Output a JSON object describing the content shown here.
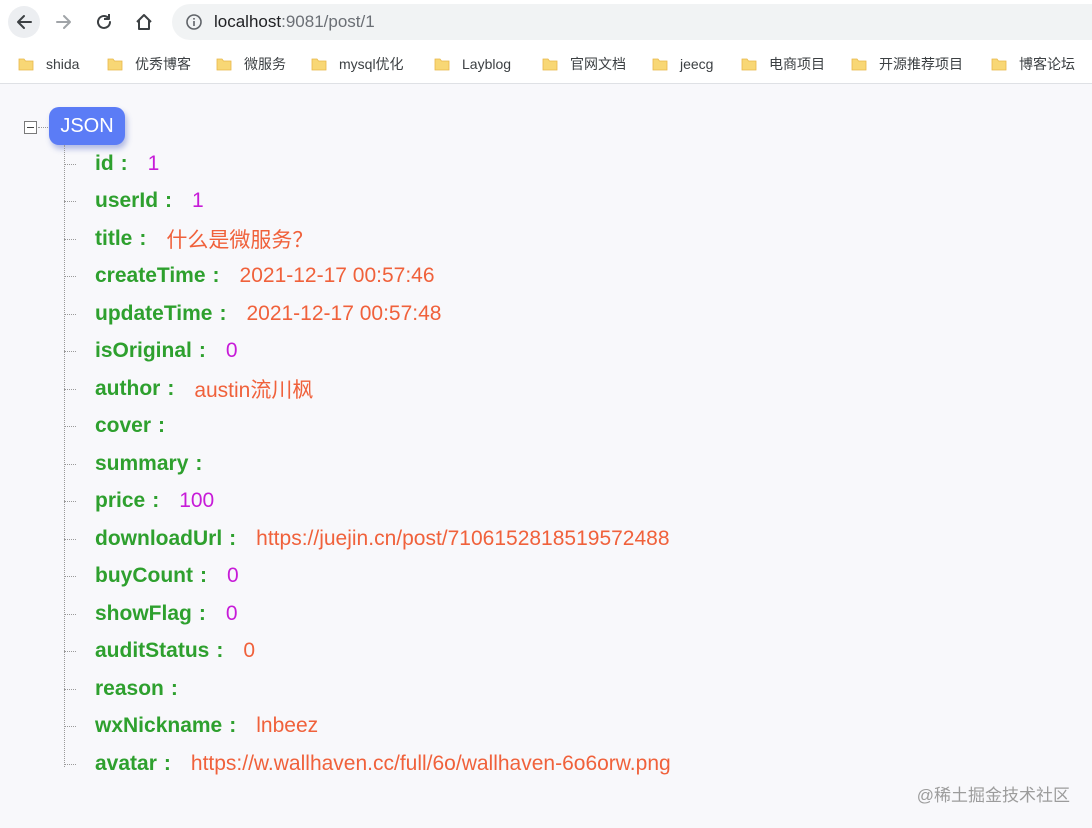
{
  "browser": {
    "url_host": "localhost",
    "url_path": ":9081/post/1",
    "bookmarks": [
      "shida",
      "优秀博客",
      "微服务",
      "mysql优化",
      "Layblog",
      "官网文档",
      "jeecg",
      "电商项目",
      "开源推荐项目",
      "博客论坛"
    ]
  },
  "viewer": {
    "root_label": "JSON",
    "rows": [
      {
        "key": "id",
        "colon": ":",
        "value": "1",
        "type": "num"
      },
      {
        "key": "userId",
        "colon": ":",
        "value": "1",
        "type": "num"
      },
      {
        "key": "title",
        "colon": ":",
        "value": "什么是微服务？",
        "type": "str"
      },
      {
        "key": "createTime",
        "colon": ":",
        "value": "2021-12-17 00:57:46",
        "type": "str"
      },
      {
        "key": "updateTime",
        "colon": ":",
        "value": "2021-12-17 00:57:48",
        "type": "str"
      },
      {
        "key": "isOriginal",
        "colon": ":",
        "value": "0",
        "type": "num"
      },
      {
        "key": "author",
        "colon": ":",
        "value": "austin流川枫",
        "type": "str"
      },
      {
        "key": "cover",
        "colon": ":",
        "value": "",
        "type": "str"
      },
      {
        "key": "summary",
        "colon": ":",
        "value": "",
        "type": "str"
      },
      {
        "key": "price",
        "colon": ":",
        "value": "100",
        "type": "num"
      },
      {
        "key": "downloadUrl",
        "colon": ":",
        "value": "https://juejin.cn/post/7106152818519572488",
        "type": "str"
      },
      {
        "key": "buyCount",
        "colon": ":",
        "value": "0",
        "type": "num"
      },
      {
        "key": "showFlag",
        "colon": ":",
        "value": "0",
        "type": "num"
      },
      {
        "key": "auditStatus",
        "colon": ":",
        "value": "0",
        "type": "str"
      },
      {
        "key": "reason",
        "colon": ":",
        "value": "",
        "type": "str"
      },
      {
        "key": "wxNickname",
        "colon": ":",
        "value": "lnbeez",
        "type": "str"
      },
      {
        "key": "avatar",
        "colon": ":",
        "value": "https://w.wallhaven.cc/full/6o/wallhaven-6o6orw.png",
        "type": "str"
      }
    ]
  },
  "watermark": "@稀土掘金技术社区",
  "icons": {
    "back": "arrow-left-icon",
    "forward": "arrow-right-icon",
    "reload": "reload-icon",
    "home": "home-icon",
    "info": "info-icon",
    "bookmark": "folder-icon",
    "collapse": "collapse-minus-icon"
  },
  "colors": {
    "key": "#2ea02e",
    "number": "#c71bd8",
    "string": "#f0613b",
    "root_badge": "#5b7cf6"
  }
}
